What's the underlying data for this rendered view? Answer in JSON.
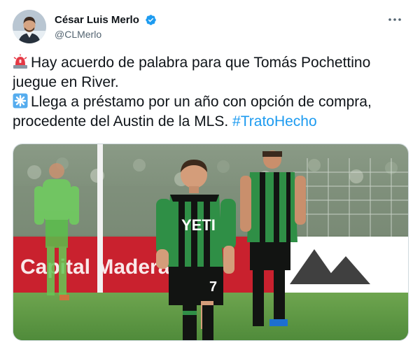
{
  "author": {
    "display_name": "César Luis Merlo",
    "handle": "@CLMerlo",
    "verified": true,
    "avatar_icon": "profile-photo",
    "more_icon": "more-horizontal-icon"
  },
  "tweet": {
    "line1_icon": "rotating-light-emoji",
    "line1": "Hay acuerdo de palabra para que Tomás Pochettino",
    "line2": "juegue en River.",
    "line3_icon": "eight-spoked-asterisk-emoji",
    "line3": "Llega a préstamo por un año con opción de compra,",
    "line4": "procedente del Austin de la MLS.",
    "hashtag": "#TratoHecho"
  },
  "media": {
    "image_icon": "soccer-player-photo",
    "jersey_sponsor": "YETI",
    "jersey_number": "7",
    "board_text": "Capital Madera"
  },
  "colors": {
    "link": "#1d9bf0",
    "verified": "#1d9bf0",
    "handle": "#536471",
    "jersey_green": "#2f8f46",
    "jersey_black": "#121412"
  }
}
